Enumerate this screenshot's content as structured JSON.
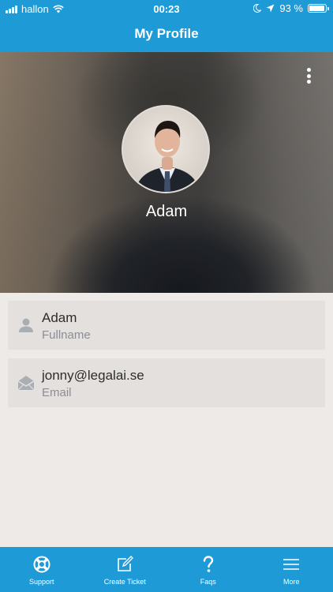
{
  "status_bar": {
    "carrier": "hallon",
    "time": "00:23",
    "battery_percent": "93 %",
    "battery_level": 0.93
  },
  "header": {
    "title": "My Profile"
  },
  "profile": {
    "name": "Adam",
    "fields": [
      {
        "value": "Adam",
        "label": "Fullname",
        "icon": "person-icon"
      },
      {
        "value": "jonny@legalai.se",
        "label": "Email",
        "icon": "envelope-icon"
      }
    ]
  },
  "tabs": [
    {
      "label": "Support",
      "icon": "lifebuoy-icon"
    },
    {
      "label": "Create Ticket",
      "icon": "edit-icon"
    },
    {
      "label": "Faqs",
      "icon": "question-icon"
    },
    {
      "label": "More",
      "icon": "menu-icon"
    }
  ],
  "colors": {
    "primary": "#1e9ad6",
    "background": "#eeeae8",
    "card": "#e4e0de",
    "text": "#2d2d2d",
    "muted": "#8a8e94"
  }
}
